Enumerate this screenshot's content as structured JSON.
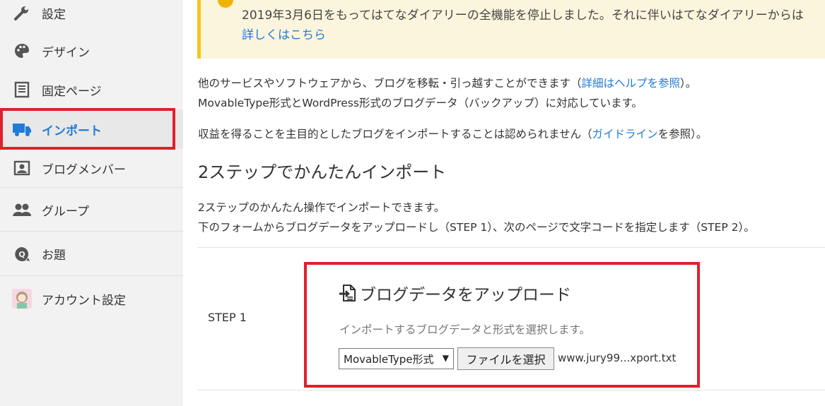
{
  "sidebar": {
    "items": [
      {
        "label": "設定",
        "icon": "wrench-icon"
      },
      {
        "label": "デザイン",
        "icon": "palette-icon"
      },
      {
        "label": "固定ページ",
        "icon": "page-icon"
      },
      {
        "label": "インポート",
        "icon": "truck-icon"
      },
      {
        "label": "ブログメンバー",
        "icon": "member-icon"
      },
      {
        "label": "グループ",
        "icon": "group-icon"
      },
      {
        "label": "お題",
        "icon": "question-icon"
      },
      {
        "label": "アカウント設定",
        "icon": "avatar-icon"
      }
    ],
    "active_index": 3,
    "accent_color": "#1f7bd6"
  },
  "notice": {
    "text": "2019年3月6日をもってはてなダイアリーの全機能を停止しました。それに伴いはてなダイアリーからは",
    "link": "詳しくはこちら"
  },
  "intro": {
    "line1_pre": "他のサービスやソフトウェアから、ブログを移転・引っ越すことができます（",
    "line1_link": "詳細はヘルプを参照",
    "line1_post": "）。",
    "line2": "MovableType形式とWordPress形式のブログデータ（バックアップ）に対応しています。",
    "line3_pre": "収益を得ることを主目的としたブログをインポートすることは認められません（",
    "line3_link": "ガイドライン",
    "line3_post": "を参照）。"
  },
  "section": {
    "title": "2ステップでかんたんインポート",
    "desc1": "2ステップのかんたん操作でインポートできます。",
    "desc2": "下のフォームからブログデータをアップロードし（STEP 1）、次のページで文字コードを指定します（STEP 2）。"
  },
  "step1": {
    "label": "STEP 1",
    "title": "ブログデータをアップロード",
    "desc": "インポートするブログデータと形式を選択します。",
    "format_selected": "MovableType形式",
    "file_button": "ファイルを選択",
    "file_name": "www.jury99...xport.txt"
  },
  "highlight_color": "#e0202c"
}
